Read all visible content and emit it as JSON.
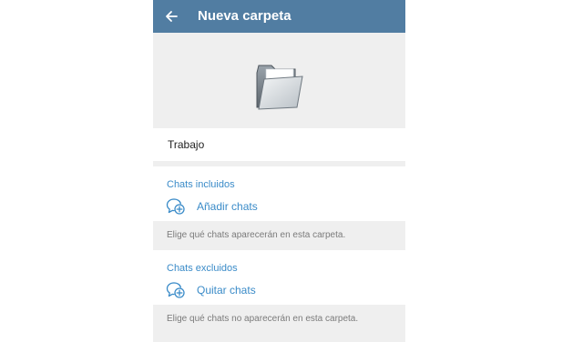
{
  "header": {
    "title": "Nueva carpeta",
    "background": "#517da2",
    "back_icon": "arrow-left-icon"
  },
  "hero": {
    "icon": "folder-icon"
  },
  "folder_name": {
    "value": "Trabajo"
  },
  "included": {
    "header": "Chats incluidos",
    "action_label": "Añadir chats",
    "action_icon": "chat-add-icon",
    "hint": "Elige qué chats aparecerán en esta carpeta."
  },
  "excluded": {
    "header": "Chats excluidos",
    "action_label": "Quitar chats",
    "action_icon": "chat-add-icon",
    "hint": "Elige qué chats no aparecerán en esta carpeta."
  },
  "colors": {
    "accent": "#3a8bc8",
    "section_background": "#efefef"
  }
}
